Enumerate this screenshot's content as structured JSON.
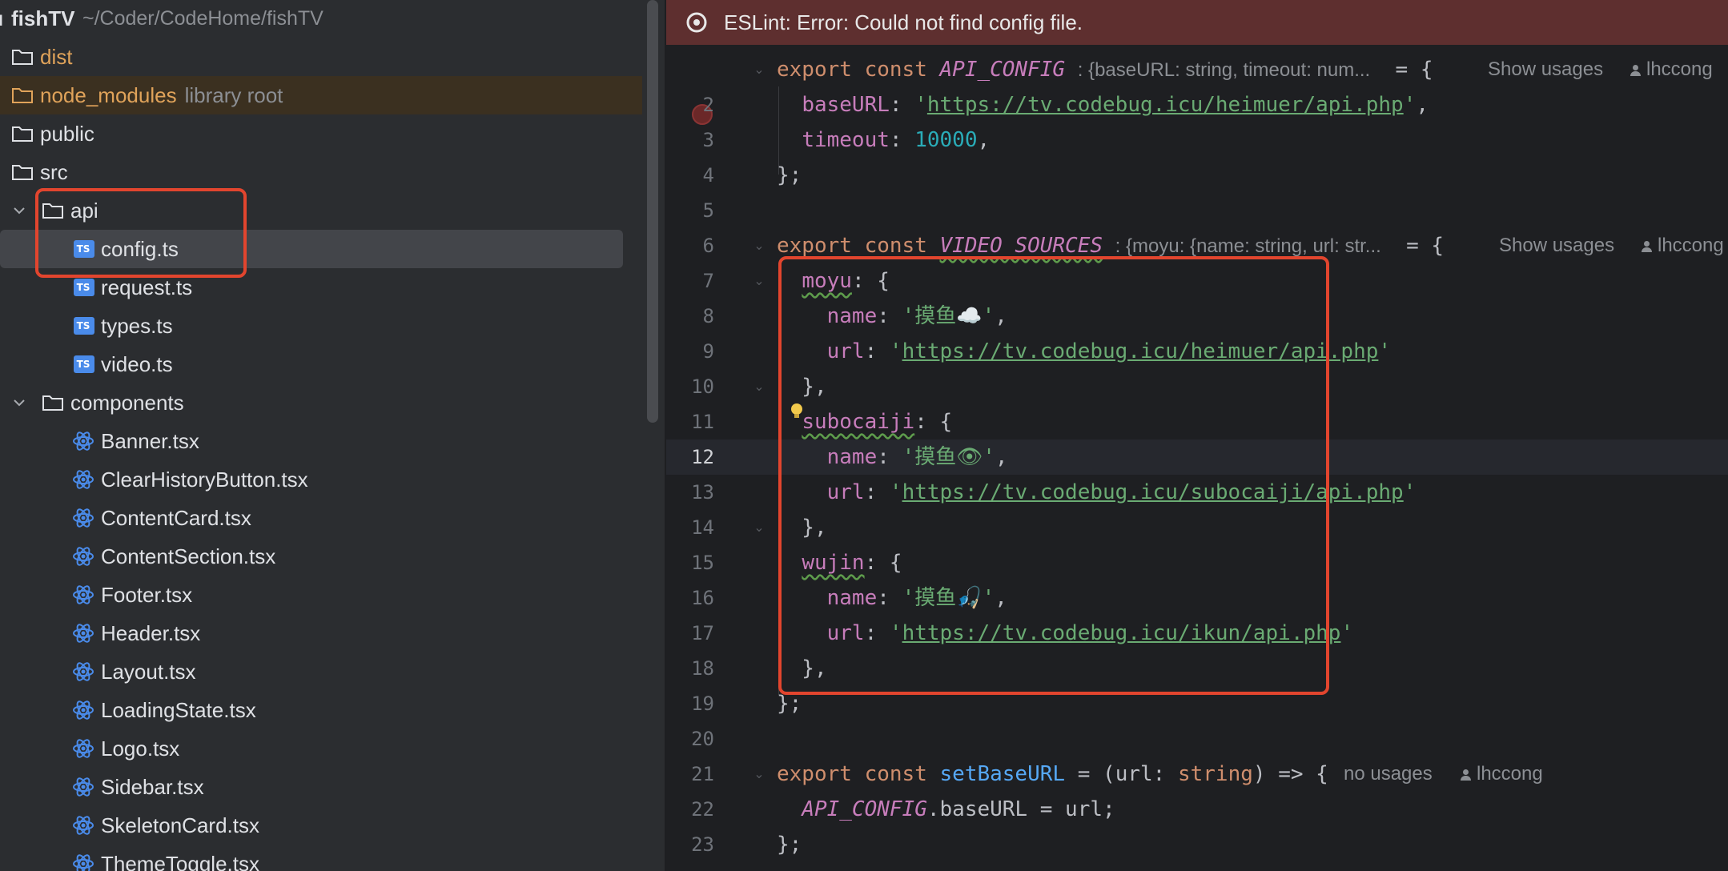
{
  "project": {
    "root_name": "fishTV",
    "root_path": "~/Coder/CodeHome/fishTV",
    "items": [
      {
        "label": "dist",
        "kind": "folder",
        "color": "#e0a35a"
      },
      {
        "label": "node_modules",
        "hint": "library root",
        "kind": "folder",
        "color": "#e0a35a"
      },
      {
        "label": "public",
        "kind": "folder"
      },
      {
        "label": "src",
        "kind": "folder"
      },
      {
        "label": "api",
        "kind": "folder",
        "expanded": true
      },
      {
        "label": "config.ts",
        "kind": "ts",
        "selected": true
      },
      {
        "label": "request.ts",
        "kind": "ts"
      },
      {
        "label": "types.ts",
        "kind": "ts"
      },
      {
        "label": "video.ts",
        "kind": "ts"
      },
      {
        "label": "components",
        "kind": "folder",
        "expanded": true
      },
      {
        "label": "Banner.tsx",
        "kind": "react"
      },
      {
        "label": "ClearHistoryButton.tsx",
        "kind": "react"
      },
      {
        "label": "ContentCard.tsx",
        "kind": "react"
      },
      {
        "label": "ContentSection.tsx",
        "kind": "react"
      },
      {
        "label": "Footer.tsx",
        "kind": "react"
      },
      {
        "label": "Header.tsx",
        "kind": "react"
      },
      {
        "label": "Layout.tsx",
        "kind": "react"
      },
      {
        "label": "LoadingState.tsx",
        "kind": "react"
      },
      {
        "label": "Logo.tsx",
        "kind": "react"
      },
      {
        "label": "Sidebar.tsx",
        "kind": "react"
      },
      {
        "label": "SkeletonCard.tsx",
        "kind": "react"
      },
      {
        "label": "ThemeToggle.tsx",
        "kind": "react"
      }
    ]
  },
  "editor": {
    "banner": "ESLint: Error: Could not find config file.",
    "line_numbers": [
      "2",
      "3",
      "4",
      "5",
      "6",
      "7",
      "8",
      "9",
      "10",
      "11",
      "12",
      "13",
      "14",
      "15",
      "16",
      "17",
      "18",
      "19",
      "20",
      "21",
      "22",
      "23"
    ],
    "current_line": "12",
    "hints": {
      "api_config_type": ": {baseURL: string, timeout: num...",
      "video_sources_type": ": {moyu: {name: string, url: str...",
      "show_usages": "Show usages",
      "no_usages": "no usages",
      "author": "lhccong"
    },
    "code": {
      "export": "export",
      "const": "const",
      "api_config": "API_CONFIG",
      "video_sources": "VIDEO_SOURCES",
      "set_base_url": "setBaseURL",
      "assign_brace": "= {",
      "baseURL_key": "baseURL",
      "timeout_key": "timeout",
      "timeout_val": "10000",
      "close_obj": "};",
      "moyu": "moyu",
      "subocaiji": "subocaiji",
      "wujin": "wujin",
      "name_key": "name",
      "url_key": "url",
      "name_moyu": "摸鱼☁️",
      "name_subocaiji": "摸鱼👁",
      "name_wujin": "摸鱼🎣",
      "url_api": "https://tv.codebug.icu/heimuer/api.php",
      "url_moyu": "https://tv.codebug.icu/heimuer/api.php",
      "url_subocaiji": "https://tv.codebug.icu/subocaiji/api.php",
      "url_wujin": "https://tv.codebug.icu/ikun/api.php",
      "param_url": "url",
      "param_type": "string",
      "body_target": "API_CONFIG",
      "body_rest": ".baseURL = url;"
    }
  }
}
